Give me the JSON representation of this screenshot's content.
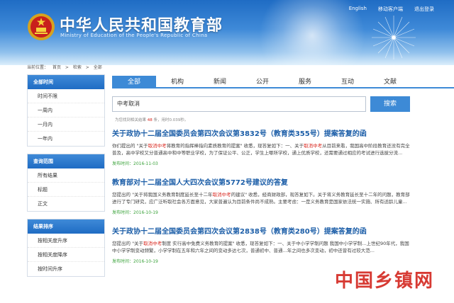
{
  "top_nav": [
    "English",
    "移动客户端",
    "退出登录"
  ],
  "site": {
    "title": "中华人民共和国教育部",
    "subtitle": "Ministry of Education of the People's Republic of China"
  },
  "breadcrumb": [
    "当前位置：",
    "首页",
    ">",
    "检索",
    ">",
    "全部"
  ],
  "sidebar": {
    "time_head": "全部时间",
    "time_items": [
      "时间不限",
      "一周内",
      "一月内",
      "一年内"
    ],
    "scope_head": "查询范围",
    "scope_items": [
      "所有结果",
      "标题",
      "正文"
    ],
    "sort_head": "结果排序",
    "sort_items": [
      "按相关度升序",
      "按相关度降序",
      "按时间升序"
    ]
  },
  "tabs": [
    "全部",
    "机构",
    "新闻",
    "公开",
    "服务",
    "互动",
    "文献"
  ],
  "search": {
    "value": "中考取消",
    "button": "搜索"
  },
  "result_count": {
    "prefix": "为您找到相关结果",
    "count": "48",
    "middle": "条，用时0.039秒。"
  },
  "results": [
    {
      "title": "关于政协十二届全国委员会第四次会议第3832号（教育类355号）提案答复的函",
      "snippet": [
        {
          "t": "你们提出的 \"关于"
        },
        {
          "t": "取消中考",
          "hl": true
        },
        {
          "t": "将教育的指挥棒指向素质教育的提案\" 收悉，现答复如下：一、关于"
        },
        {
          "t": "取消中考",
          "hl": true
        },
        {
          "t": "从目前来看，我国高中阶段教育还没有完全普及，高中学校又分普通高中和中等职业学校，为了保证公平、公正，学生上哪所学校，通上优质学校，还需要通过相应的考试进行选拔分流..."
        }
      ],
      "date": "发布时间：2016-11-03"
    },
    {
      "title": "教育部对十二届全国人大四次会议第5772号建议的答复",
      "snippet": [
        {
          "t": "您提出的 \"关于将我国义务教育制度延长至十二年"
        },
        {
          "t": "取消中考",
          "hl": true
        },
        {
          "t": "的建议\" 收悉，经商财政部，现答复如下。关于将义务教育延长至十二年的问题，教育部进行了专门研究，应广泛听取社会各方面意见，大家普遍认为目前条件尚不成熟。主要考虑：一是义务教育是国家依法统一实施、所有适龄儿童..."
        }
      ],
      "date": "发布时间：2016-10-19"
    },
    {
      "title": "关于政协十二届全国委员会第四次会议第2838号（教育类280号）提案答复的函",
      "snippet": [
        {
          "t": "您提出的 \"关于"
        },
        {
          "t": "取消中考",
          "hl": true
        },
        {
          "t": "制度 实行高中免费义务教育的提案\" 收悉，现答复如下：一、关于中小学学制问题 我国中小学学制..."
        },
        {
          "t": "上世纪90年代，我国中小学学制变动频繁，小学学制在五年和六年之间的变动多达七次，普通初中、普通..."
        },
        {
          "t": "年之间也多次变动，初中还曾有过较大范..."
        }
      ],
      "date": "发布时间：2016-10-19"
    }
  ],
  "watermark": "中国乡镇网"
}
